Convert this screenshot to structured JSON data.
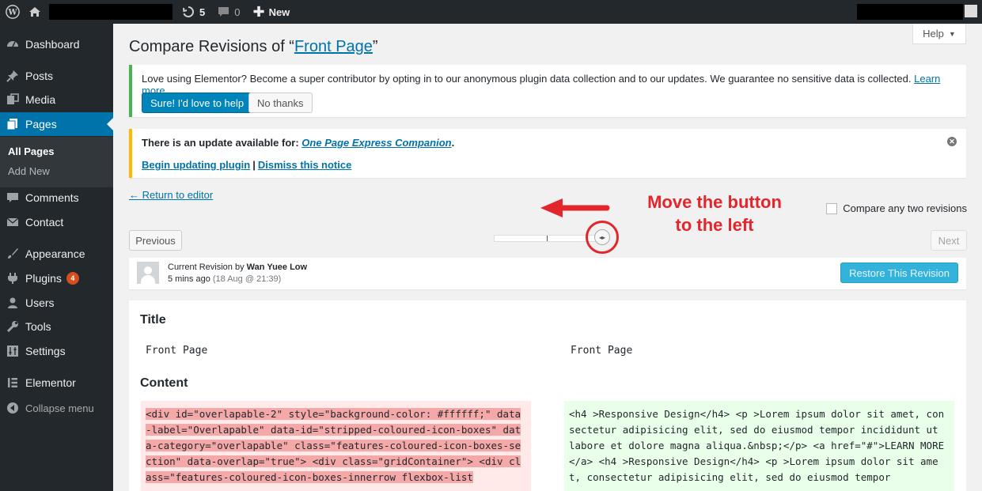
{
  "adminbar": {
    "updates_count": "5",
    "comments_count": "0",
    "new_label": "New"
  },
  "sidebar": {
    "items": [
      {
        "label": "Dashboard",
        "icon": "dashboard-icon"
      },
      {
        "label": "Posts",
        "icon": "pin-icon"
      },
      {
        "label": "Media",
        "icon": "media-icon"
      },
      {
        "label": "Pages",
        "icon": "pages-icon"
      },
      {
        "label": "Comments",
        "icon": "comment-icon"
      },
      {
        "label": "Contact",
        "icon": "mail-icon"
      },
      {
        "label": "Appearance",
        "icon": "brush-icon"
      },
      {
        "label": "Plugins",
        "icon": "plugin-icon",
        "badge": "4"
      },
      {
        "label": "Users",
        "icon": "user-icon"
      },
      {
        "label": "Tools",
        "icon": "wrench-icon"
      },
      {
        "label": "Settings",
        "icon": "settings-icon"
      },
      {
        "label": "Elementor",
        "icon": "elementor-icon"
      },
      {
        "label": "Collapse menu",
        "icon": "collapse-icon"
      }
    ],
    "submenu": [
      {
        "label": "All Pages"
      },
      {
        "label": "Add New"
      }
    ]
  },
  "help": {
    "label": "Help"
  },
  "page": {
    "title_prefix": "Compare Revisions of “",
    "title_link": "Front Page",
    "title_suffix": "”"
  },
  "notice_elementor": {
    "text": "Love using Elementor? Become a super contributor by opting in to our anonymous plugin data collection and to our updates. We guarantee no sensitive data is collected.",
    "learn_more": "Learn more.",
    "accept": "Sure! I'd love to help",
    "decline": "No thanks"
  },
  "notice_update": {
    "text": "There is an update available for:",
    "plugin": "One Page Express Companion",
    "period": ".",
    "begin": "Begin updating plugin",
    "separator": "|",
    "dismiss": "Dismiss this notice"
  },
  "return_link": "← Return to editor",
  "compare_label": "Compare any two revisions",
  "annotation": {
    "line1": "Move the button",
    "line2": "to the left",
    "color": "#e3252c"
  },
  "nav": {
    "previous": "Previous",
    "next": "Next"
  },
  "revision": {
    "label": "Current Revision",
    "by": "by",
    "author": "Wan Yuee Low",
    "time": "5 mins ago",
    "date": "(18 Aug @ 21:39)",
    "restore": "Restore This Revision"
  },
  "diff": {
    "title_heading": "Title",
    "title_left": "Front Page",
    "title_right": "Front Page",
    "content_heading": "Content",
    "content_left": "<div id=\"overlapable-2\" style=\"background-color: #ffffff;\" data-label=\"Overlapable\" data-id=\"stripped-coloured-icon-boxes\" data-category=\"overlapable\" class=\"features-coloured-icon-boxes-section\" data-overlap=\"true\"> <div class=\"gridContainer\"> <div class=\"features-coloured-icon-boxes-innerrow flexbox-list",
    "content_right": "<h4 >Responsive Design</h4> <p >Lorem ipsum dolor sit amet, consectetur adipisicing elit, sed do eiusmod tempor incididunt ut labore et dolore magna aliqua.&nbsp;</p> <a href=\"#\">LEARN MORE</a> <h4 >Responsive Design</h4> <p >Lorem ipsum dolor sit amet, consectetur adipisicing elit, sed do eiusmod tempor"
  },
  "colors": {
    "admin_dark": "#23282d",
    "accent": "#0073aa",
    "success": "#46b450",
    "warning": "#ffb900",
    "diff_deleted": "#ffe9e9",
    "diff_added": "#e9ffe9"
  }
}
